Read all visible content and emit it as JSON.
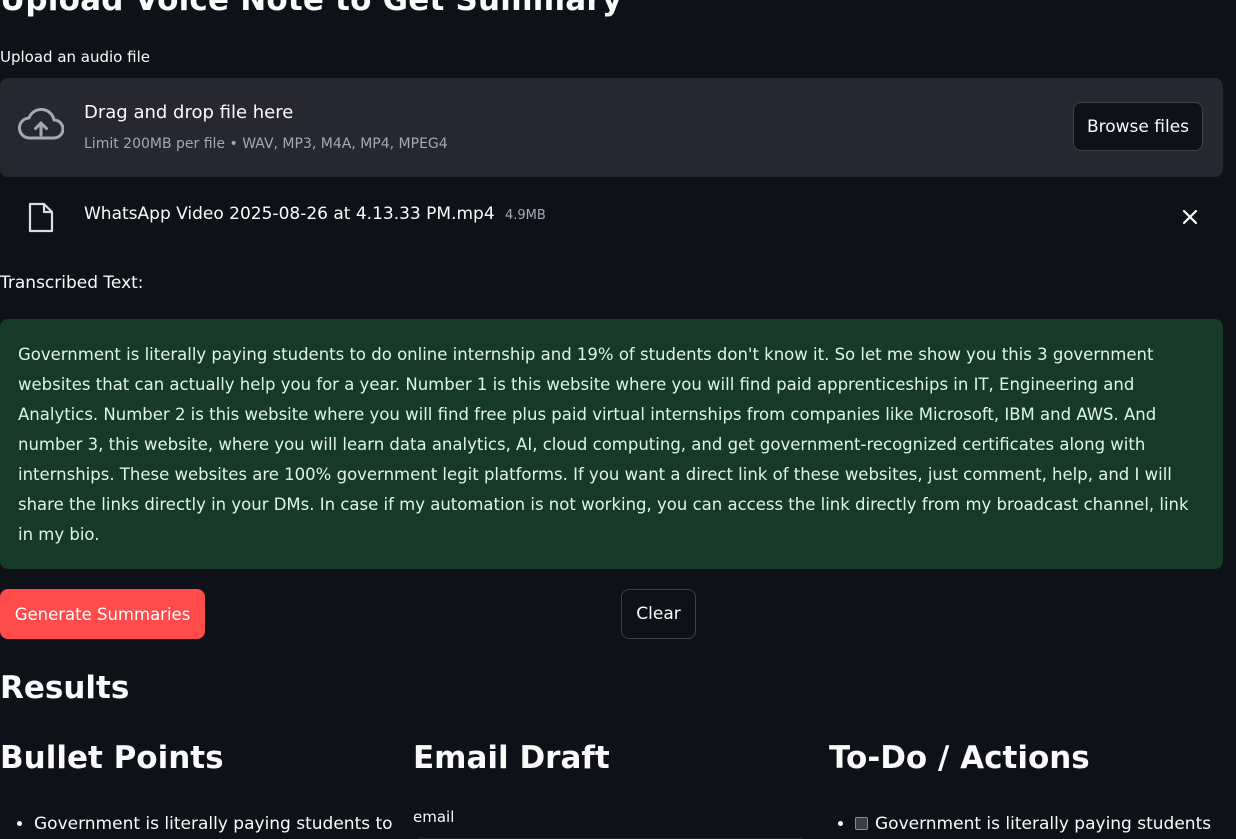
{
  "page_title": "Upload Voice Note to Get Summary",
  "uploader": {
    "label": "Upload an audio file",
    "drop_title": "Drag and drop file here",
    "drop_limit": "Limit 200MB per file • WAV, MP3, M4A, MP4, MPEG4",
    "browse_label": "Browse files",
    "icon": "cloud-upload-icon"
  },
  "uploaded_file": {
    "name": "WhatsApp Video 2025-08-26 at 4.13.33 PM.mp4",
    "size": "4.9MB",
    "icon": "file-icon"
  },
  "transcript": {
    "label": "Transcribed Text:",
    "text": "Government is literally paying students to do online internship and 19% of students don't know it. So let me show you this 3 government websites that can actually help you for a year. Number 1 is this website where you will find paid apprenticeships in IT, Engineering and Analytics. Number 2 is this website where you will find free plus paid virtual internships from companies like Microsoft, IBM and AWS. And number 3, this website, where you will learn data analytics, AI, cloud computing, and get government-recognized certificates along with internships. These websites are 100% government legit platforms. If you want a direct link of these websites, just comment, help, and I will share the links directly in your DMs. In case if my automation is not working, you can access the link directly from my broadcast channel, link in my bio."
  },
  "actions": {
    "generate_label": "Generate Summaries",
    "clear_label": "Clear"
  },
  "results": {
    "heading": "Results",
    "bullets": {
      "heading": "Bullet Points",
      "items": [
        "Government is literally paying students to"
      ]
    },
    "email": {
      "heading": "Email Draft",
      "field_label": "email"
    },
    "todo": {
      "heading": "To-Do / Actions",
      "items": [
        "Government is literally paying students"
      ]
    }
  },
  "colors": {
    "background": "#0e1117",
    "widget_bg": "#262730",
    "primary_button": "#ff4b4b",
    "success_box_bg": "#173928",
    "success_box_text": "#dff5e4"
  }
}
